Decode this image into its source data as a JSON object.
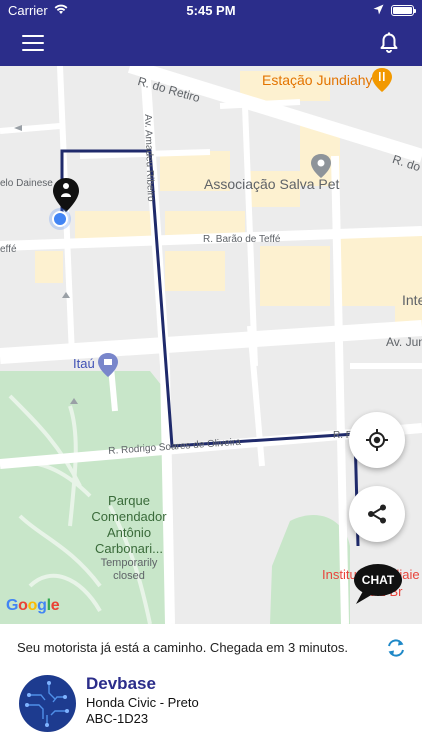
{
  "status_bar": {
    "carrier": "Carrier",
    "time": "5:45 PM"
  },
  "nav": {
    "menu_icon": "hamburger-menu-icon",
    "notification_icon": "bell-icon"
  },
  "map": {
    "streets": {
      "r_do_retiro": "R. do Retiro",
      "r_do_right": "R. do",
      "av_amadeu_ribeiro": "Av. Amadeu Ribeiro",
      "r_barao_de_teffe": "R. Barão de Teffé",
      "effe_left": "effé",
      "elo_dainese": "elo Dainese",
      "av_jun": "Av. Jun",
      "r_rodrigo_soares": "R. Rodrigo Soares de Oliveira",
      "r_roc": "R. Roc"
    },
    "places": {
      "estacao": "Estação Jundiahy",
      "associacao": "Associação Salva Pet",
      "inte": "Inte",
      "itau": "Itaú",
      "parque_line1": "Parque",
      "parque_line2": "Comendador",
      "parque_line3": "Antônio",
      "parque_line4": "Carbonari...",
      "parque_status1": "Temporarily",
      "parque_status2": "closed",
      "instituto_line1": "Instituto Jundiaie",
      "instituto_line2": "Luiz Br"
    },
    "google_logo": "Google",
    "colors": {
      "route": "#1f2a6b",
      "accent": "#2b2d8a",
      "park": "#c8e6c9",
      "block": "#fdf1d0"
    }
  },
  "buttons": {
    "locate_icon": "crosshair-icon",
    "share_icon": "share-icon",
    "chat_label": "CHAT"
  },
  "panel": {
    "eta": "Seu motorista já está a caminho. Chegada em 3 minutos.",
    "refresh_icon": "refresh-icon",
    "driver_name": "Devbase",
    "vehicle": "Honda Civic - Preto",
    "plate": "ABC-1D23"
  }
}
